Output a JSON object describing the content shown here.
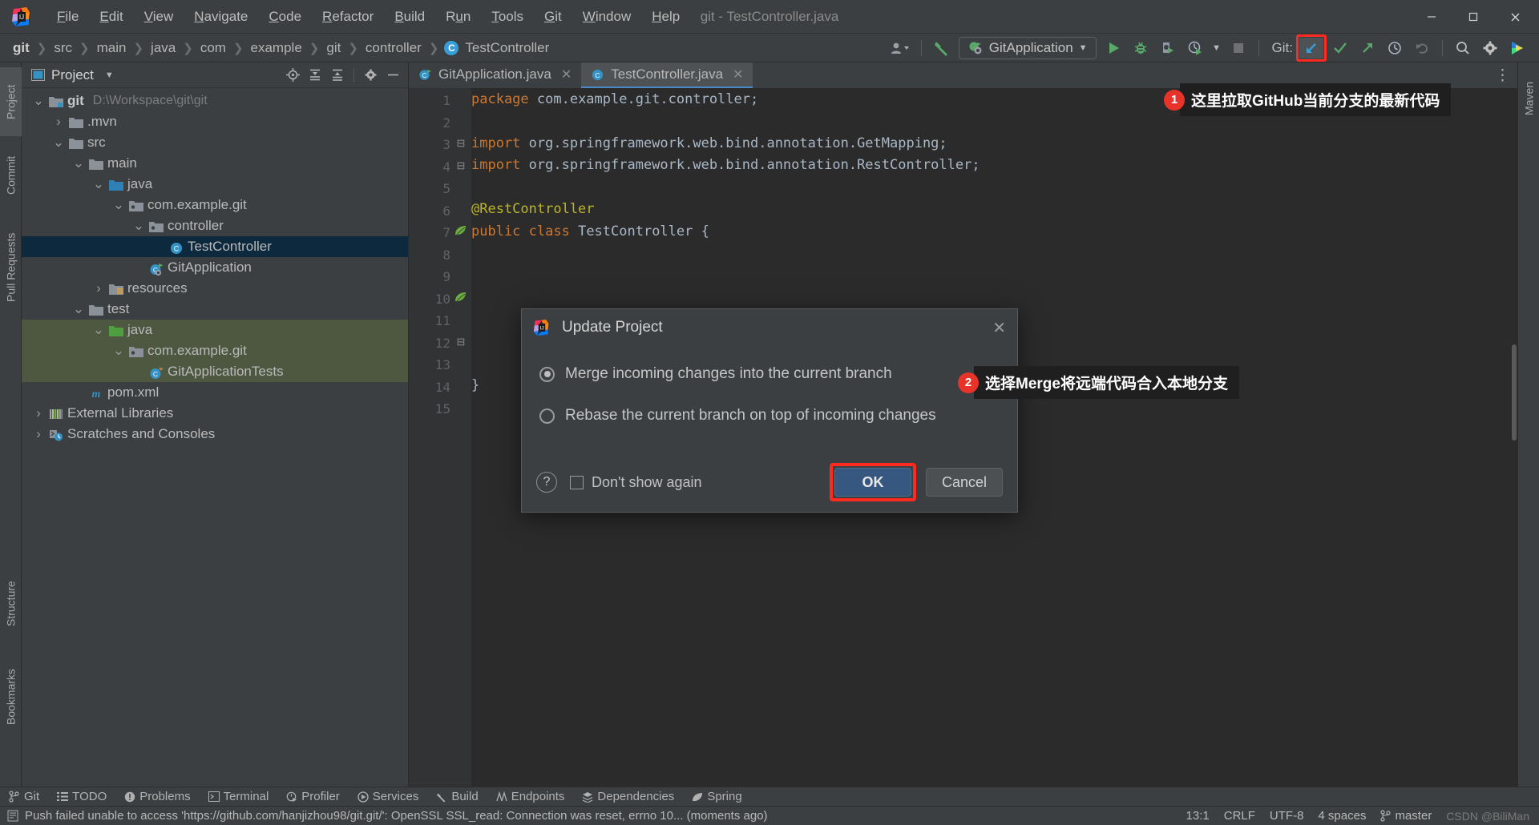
{
  "window": {
    "title": "git - TestController.java",
    "minimize_label": "—",
    "maximize_label": "❐",
    "close_label": "✕"
  },
  "menubar": {
    "items": [
      {
        "label": "File",
        "mnemonic": "F"
      },
      {
        "label": "Edit",
        "mnemonic": "E"
      },
      {
        "label": "View",
        "mnemonic": "V"
      },
      {
        "label": "Navigate",
        "mnemonic": "N"
      },
      {
        "label": "Code",
        "mnemonic": "C"
      },
      {
        "label": "Refactor",
        "mnemonic": "R"
      },
      {
        "label": "Build",
        "mnemonic": "B"
      },
      {
        "label": "Run",
        "mnemonic": "u"
      },
      {
        "label": "Tools",
        "mnemonic": "T"
      },
      {
        "label": "Git",
        "mnemonic": "G"
      },
      {
        "label": "Window",
        "mnemonic": "W"
      },
      {
        "label": "Help",
        "mnemonic": "H"
      }
    ]
  },
  "breadcrumbs": {
    "items": [
      "git",
      "src",
      "main",
      "java",
      "com",
      "example",
      "git",
      "controller"
    ],
    "final": "TestController",
    "final_badge": "C",
    "separator": "›"
  },
  "toolbar": {
    "run_config": "GitApplication",
    "git_label": "Git:",
    "icons": {
      "user_dropdown": "user-settings-icon",
      "build_hammer": "build-icon",
      "run": "run-icon",
      "debug": "debug-icon",
      "run_coverage": "run-with-coverage-icon",
      "profiler": "profiler-icon",
      "stop": "stop-icon",
      "git_update": "git-update-icon",
      "git_commit": "git-commit-icon",
      "git_push": "git-push-icon",
      "git_history": "git-history-icon",
      "git_rollback": "git-rollback-icon",
      "search": "search-everywhere-icon",
      "settings": "settings-gear-icon",
      "assistant": "ai-assistant-icon"
    }
  },
  "left_strip": {
    "tabs": [
      "Project",
      "Commit",
      "Pull Requests",
      "Structure",
      "Bookmarks"
    ]
  },
  "right_strip": {
    "tabs": [
      "Maven"
    ]
  },
  "project_panel": {
    "title": "Project",
    "header_icons": [
      "locate-icon",
      "expand-all-icon",
      "collapse-all-icon",
      "settings-gear-icon",
      "hide-icon"
    ],
    "tree": [
      {
        "depth": 0,
        "chevron": "down",
        "icon": "module-folder",
        "label": "git",
        "bold": true,
        "path": "D:\\Workspace\\git\\git",
        "state": "normal"
      },
      {
        "depth": 1,
        "chevron": "right",
        "icon": "folder-gray",
        "label": ".mvn",
        "bold": false,
        "path": "",
        "state": "normal"
      },
      {
        "depth": 1,
        "chevron": "down",
        "icon": "folder-gray",
        "label": "src",
        "bold": false,
        "path": "",
        "state": "normal"
      },
      {
        "depth": 2,
        "chevron": "down",
        "icon": "folder-gray",
        "label": "main",
        "bold": false,
        "path": "",
        "state": "normal"
      },
      {
        "depth": 3,
        "chevron": "down",
        "icon": "folder-blue",
        "label": "java",
        "bold": false,
        "path": "",
        "state": "normal"
      },
      {
        "depth": 4,
        "chevron": "down",
        "icon": "package",
        "label": "com.example.git",
        "bold": false,
        "path": "",
        "state": "normal"
      },
      {
        "depth": 5,
        "chevron": "down",
        "icon": "package",
        "label": "controller",
        "bold": false,
        "path": "",
        "state": "normal"
      },
      {
        "depth": 6,
        "chevron": "none",
        "icon": "class",
        "label": "TestController",
        "bold": false,
        "path": "",
        "state": "selected"
      },
      {
        "depth": 5,
        "chevron": "none",
        "icon": "class-run",
        "label": "GitApplication",
        "bold": false,
        "path": "",
        "state": "normal"
      },
      {
        "depth": 3,
        "chevron": "right",
        "icon": "folder-res",
        "label": "resources",
        "bold": false,
        "path": "",
        "state": "normal"
      },
      {
        "depth": 2,
        "chevron": "down",
        "icon": "folder-gray",
        "label": "test",
        "bold": false,
        "path": "",
        "state": "normal"
      },
      {
        "depth": 3,
        "chevron": "down",
        "icon": "folder-green",
        "label": "java",
        "bold": false,
        "path": "",
        "state": "test"
      },
      {
        "depth": 4,
        "chevron": "down",
        "icon": "package",
        "label": "com.example.git",
        "bold": false,
        "path": "",
        "state": "test"
      },
      {
        "depth": 5,
        "chevron": "none",
        "icon": "class-test",
        "label": "GitApplicationTests",
        "bold": false,
        "path": "",
        "state": "test"
      },
      {
        "depth": 2,
        "chevron": "none",
        "icon": "maven",
        "label": "pom.xml",
        "bold": false,
        "path": "",
        "state": "normal"
      },
      {
        "depth": 0,
        "chevron": "right",
        "icon": "libraries",
        "label": "External Libraries",
        "bold": false,
        "path": "",
        "state": "normal"
      },
      {
        "depth": 0,
        "chevron": "right",
        "icon": "scratches",
        "label": "Scratches and Consoles",
        "bold": false,
        "path": "",
        "state": "normal"
      }
    ]
  },
  "editor": {
    "tabs": [
      {
        "label": "GitApplication.java",
        "icon": "class-run",
        "active": false
      },
      {
        "label": "TestController.java",
        "icon": "class",
        "active": true
      }
    ],
    "close_glyph": "✕",
    "more_glyph": "⋮",
    "lines": [
      {
        "n": 1,
        "gutter": "",
        "tokens": [
          {
            "t": "package ",
            "c": "kw"
          },
          {
            "t": "com.example.git.controller;",
            "c": "pl"
          }
        ]
      },
      {
        "n": 2,
        "gutter": "",
        "tokens": []
      },
      {
        "n": 3,
        "gutter": "fold",
        "tokens": [
          {
            "t": "import ",
            "c": "kw"
          },
          {
            "t": "org.springframework.web.bind.annotation.",
            "c": "pl"
          },
          {
            "t": "GetMapping",
            "c": "cls"
          },
          {
            "t": ";",
            "c": "pl"
          }
        ]
      },
      {
        "n": 4,
        "gutter": "fold",
        "tokens": [
          {
            "t": "import ",
            "c": "kw"
          },
          {
            "t": "org.springframework.web.bind.annotation.",
            "c": "pl"
          },
          {
            "t": "RestController",
            "c": "cls"
          },
          {
            "t": ";",
            "c": "pl"
          }
        ]
      },
      {
        "n": 5,
        "gutter": "",
        "tokens": []
      },
      {
        "n": 6,
        "gutter": "",
        "tokens": [
          {
            "t": "@RestController",
            "c": "ann"
          }
        ]
      },
      {
        "n": 7,
        "gutter": "bean",
        "tokens": [
          {
            "t": "public ",
            "c": "kw"
          },
          {
            "t": "class ",
            "c": "kw"
          },
          {
            "t": "TestController ",
            "c": "pl"
          },
          {
            "t": "{",
            "c": "pl"
          }
        ]
      },
      {
        "n": 8,
        "gutter": "",
        "tokens": []
      },
      {
        "n": 9,
        "gutter": "",
        "tokens": []
      },
      {
        "n": 10,
        "gutter": "bean",
        "tokens": []
      },
      {
        "n": 11,
        "gutter": "",
        "tokens": []
      },
      {
        "n": 12,
        "gutter": "fold",
        "tokens": []
      },
      {
        "n": 13,
        "gutter": "",
        "tokens": []
      },
      {
        "n": 14,
        "gutter": "",
        "tokens": [
          {
            "t": "}",
            "c": "pl"
          }
        ]
      },
      {
        "n": 15,
        "gutter": "",
        "tokens": []
      }
    ]
  },
  "dialog": {
    "title": "Update Project",
    "close_glyph": "✕",
    "options": [
      {
        "label": "Merge incoming changes into the current branch",
        "selected": true
      },
      {
        "label": "Rebase the current branch on top of incoming changes",
        "selected": false
      }
    ],
    "help_glyph": "?",
    "dont_show_again": "Don't show again",
    "dont_show_again_checked": false,
    "ok_label": "OK",
    "cancel_label": "Cancel"
  },
  "callouts": [
    {
      "num": "1",
      "text": "这里拉取GitHub当前分支的最新代码"
    },
    {
      "num": "2",
      "text": "选择Merge将远端代码合入本地分支"
    }
  ],
  "tool_window_bar": {
    "items": [
      {
        "label": "Git",
        "icon": "git-branch-icon"
      },
      {
        "label": "TODO",
        "icon": "todo-list-icon"
      },
      {
        "label": "Problems",
        "icon": "problems-icon"
      },
      {
        "label": "Terminal",
        "icon": "terminal-icon"
      },
      {
        "label": "Profiler",
        "icon": "profiler-icon"
      },
      {
        "label": "Services",
        "icon": "services-icon"
      },
      {
        "label": "Build",
        "icon": "build-hammer-icon"
      },
      {
        "label": "Endpoints",
        "icon": "endpoints-icon"
      },
      {
        "label": "Dependencies",
        "icon": "dependencies-icon"
      },
      {
        "label": "Spring",
        "icon": "spring-leaf-icon"
      }
    ]
  },
  "status_bar": {
    "message": "Push failed unable to access 'https://github.com/hanjizhou98/git.git/': OpenSSL SSL_read: Connection was reset, errno 10... (moments ago)",
    "caret": "13:1",
    "line_sep": "CRLF",
    "encoding": "UTF-8",
    "indent": "4 spaces",
    "branch": "master",
    "watermark": "CSDN @BiliMan"
  },
  "colors": {
    "accent_blue": "#4a88c7",
    "highlight_red": "#ff2a20",
    "selection_blue": "#0d293e",
    "test_green": "#4e5841",
    "primary_button": "#365880",
    "panel_bg": "#3c3f41",
    "editor_bg": "#2b2b2b"
  }
}
